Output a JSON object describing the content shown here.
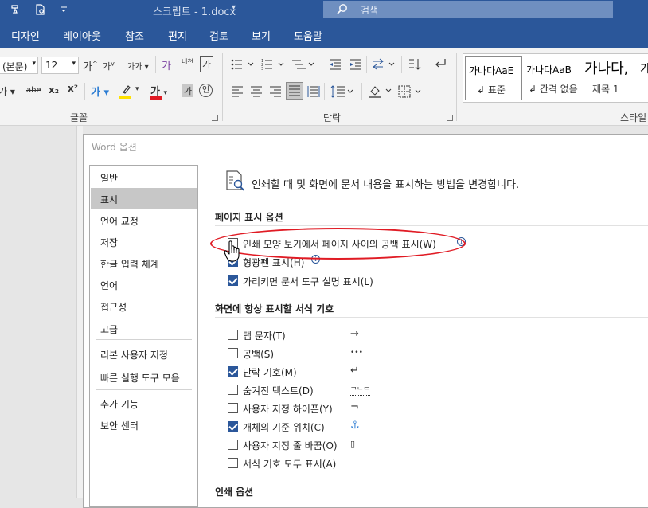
{
  "titlebar": {
    "doc_title": "스크립트 - 1.docx",
    "search_placeholder": "검색"
  },
  "menu": {
    "tabs": [
      "디자인",
      "레이아웃",
      "참조",
      "편지",
      "검토",
      "보기",
      "도움말"
    ]
  },
  "ribbon": {
    "font_name": "(본문)",
    "font_size": "12",
    "groups": {
      "font": "글꼴",
      "paragraph": "단락",
      "styles": "스타일"
    },
    "font_labels": {
      "grow": "가",
      "shrink": "가",
      "case": "가가",
      "clear": "가",
      "phonetic": "내천",
      "border_char": "가",
      "strike": "abe",
      "subscript": "x₂",
      "superscript": "x²",
      "effects": "가",
      "font_color": "가",
      "shade": "가",
      "enclose": "인",
      "underline": "가"
    },
    "styles": [
      {
        "preview": "가나다AaE",
        "name": "표준"
      },
      {
        "preview": "가나다AaB",
        "name": "간격 없음"
      },
      {
        "preview": "가나다,",
        "name": "제목 1"
      },
      {
        "preview": "가",
        "name": ""
      }
    ],
    "colors": {
      "highlight": "#ffe100",
      "font_red": "#e01b24"
    }
  },
  "dialog": {
    "title": "Word 옵션",
    "sidebar": [
      {
        "label": "일반",
        "selected": false
      },
      {
        "label": "표시",
        "selected": true
      },
      {
        "label": "언어 교정",
        "selected": false
      },
      {
        "label": "저장",
        "selected": false
      },
      {
        "label": "한글 입력 체계",
        "selected": false
      },
      {
        "label": "언어",
        "selected": false
      },
      {
        "label": "접근성",
        "selected": false
      },
      {
        "label": "고급",
        "selected": false
      },
      {
        "label": "리본 사용자 지정",
        "selected": false
      },
      {
        "label": "빠른 실행 도구 모음",
        "selected": false
      },
      {
        "label": "추가 기능",
        "selected": false
      },
      {
        "label": "보안 센터",
        "selected": false
      }
    ],
    "headline": "인쇄할 때 및 화면에 문서 내용을 표시하는 방법을 변경합니다.",
    "page_display_section": "페이지 표시 옵션",
    "page_display_options": [
      {
        "label": "인쇄 모양 보기에서 페이지 사이의 공백 표시(W)",
        "checked": false,
        "info": true
      },
      {
        "label": "형광펜 표시(H)",
        "checked": true,
        "info": true
      },
      {
        "label": "가리키면 문서 도구 설명 표시(L)",
        "checked": true,
        "info": false
      }
    ],
    "format_marks_section": "화면에 항상 표시할 서식 기호",
    "format_marks": [
      {
        "label": "탭 문자(T)",
        "checked": false,
        "symbol": "→"
      },
      {
        "label": "공백(S)",
        "checked": false,
        "symbol": "•••"
      },
      {
        "label": "단락 기호(M)",
        "checked": true,
        "symbol": "↵"
      },
      {
        "label": "숨겨진 텍스트(D)",
        "checked": false,
        "symbol": "ᄀᄂᄃ"
      },
      {
        "label": "사용자 지정 하이픈(Y)",
        "checked": false,
        "symbol": "¬"
      },
      {
        "label": "개체의 기준 위치(C)",
        "checked": true,
        "symbol": "⚓"
      },
      {
        "label": "사용자 지정 줄 바꿈(O)",
        "checked": false,
        "symbol": "▯"
      },
      {
        "label": "서식 기호 모두 표시(A)",
        "checked": false,
        "symbol": ""
      }
    ],
    "print_section": "인쇄 옵션",
    "info_glyph": "i"
  }
}
